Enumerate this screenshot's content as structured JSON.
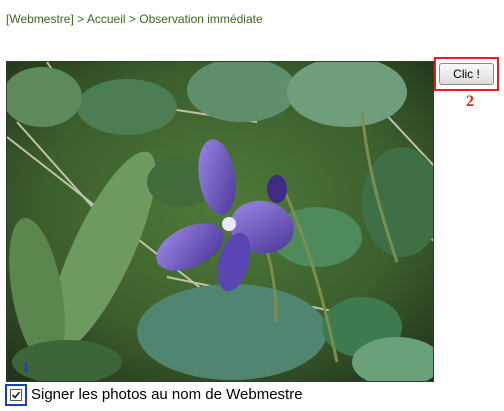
{
  "breadcrumb": {
    "items": [
      "[Webmestre]",
      "Accueil",
      "Observation immédiate"
    ],
    "separator": ">"
  },
  "photo": {
    "subject": "purple violet flower among green leaves"
  },
  "action_button": {
    "label": "Clic !"
  },
  "markers": {
    "first": "1",
    "second": "2"
  },
  "sign_option": {
    "label": "Signer les photos au nom de Webmestre",
    "checked": true
  },
  "colors": {
    "link_green": "#3a6b1f",
    "highlight_red": "#e0201f",
    "highlight_blue": "#1b3fbf"
  },
  "icons": [
    "checkmark-icon"
  ]
}
